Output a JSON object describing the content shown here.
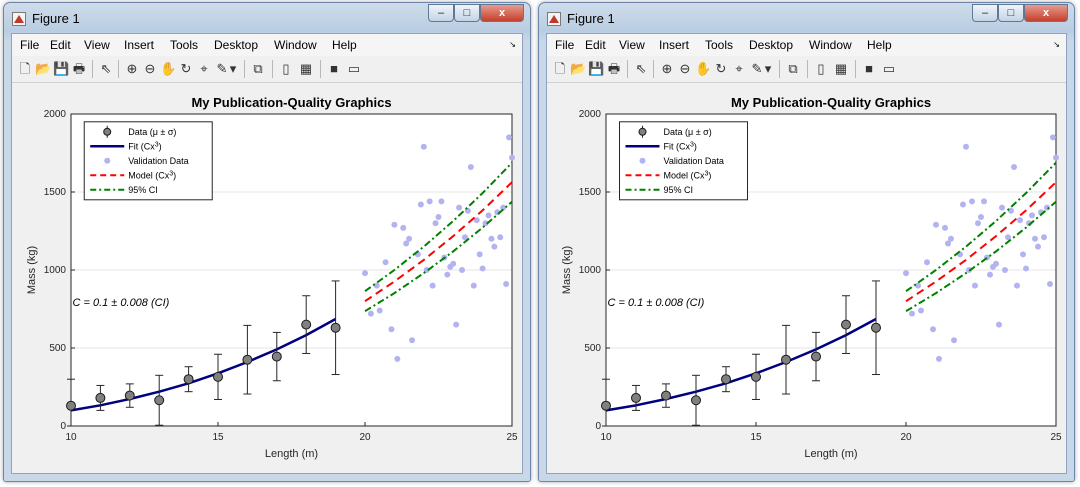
{
  "windows": [
    {
      "title": "Figure 1",
      "buttons": {
        "minimize": "–",
        "maximize": "□",
        "close": "x"
      },
      "menu": [
        "File",
        "Edit",
        "View",
        "Insert",
        "Tools",
        "Desktop",
        "Window",
        "Help"
      ],
      "menu_arrow": "↘"
    },
    {
      "title": "Figure 1",
      "buttons": {
        "minimize": "–",
        "maximize": "□",
        "close": "x"
      },
      "menu": [
        "File",
        "Edit",
        "View",
        "Insert",
        "Tools",
        "Desktop",
        "Window",
        "Help"
      ],
      "menu_arrow": "↘"
    }
  ],
  "toolbar_icons": [
    "new-figure-icon",
    "open-file-icon",
    "save-icon",
    "print-icon",
    "pointer-icon",
    "zoom-in-icon",
    "zoom-out-icon",
    "pan-icon",
    "rotate-3d-icon",
    "data-cursor-icon",
    "brush-icon",
    "brush-dropdown-icon",
    "link-plot-icon",
    "insert-colorbar-icon",
    "insert-legend-icon",
    "hide-plot-tools-icon",
    "show-plot-tools-icon"
  ],
  "toolbar_glyphs": [
    "🗋",
    "📂",
    "💾",
    "🖶",
    "⇖",
    "⊕",
    "⊖",
    "✋",
    "↻",
    "⌖",
    "✎",
    "▾",
    "⧉",
    "▯",
    "▦",
    "■",
    "▭"
  ],
  "chart_data": [
    {
      "type": "scatter",
      "title": "My Publication-Quality Graphics",
      "xlabel": "Length (m)",
      "ylabel": "Mass (kg)",
      "xlim": [
        10,
        25
      ],
      "ylim": [
        0,
        2000
      ],
      "xticks": [
        10,
        15,
        20,
        25
      ],
      "yticks": [
        0,
        500,
        1000,
        1500,
        2000
      ],
      "grid": "horizontal",
      "annotation": "C = 0.1 ± 0.008 (CI)",
      "legend": {
        "placement": "top-left",
        "entries": [
          "Data (μ ± σ)",
          "Fit (Cx³)",
          "Validation Data",
          "Model (Cx³)",
          "95% CI"
        ]
      },
      "colors": {
        "fit": "#000080",
        "validation": "#b3b3f2",
        "model": "#ff0000",
        "ci": "#008000",
        "data_marker": "#808080"
      },
      "data": {
        "x": [
          10,
          11,
          12,
          13,
          14,
          15,
          16,
          17,
          18,
          19
        ],
        "mean": [
          130,
          180,
          195,
          165,
          300,
          315,
          425,
          445,
          650,
          630
        ],
        "std": [
          170,
          80,
          75,
          160,
          80,
          145,
          220,
          155,
          185,
          300
        ]
      },
      "fit": {
        "x": [
          10,
          11,
          12,
          13,
          14,
          15,
          16,
          17,
          18,
          19
        ],
        "y": [
          100,
          133,
          173,
          220,
          274,
          338,
          410,
          491,
          583,
          686
        ]
      },
      "model": {
        "x": [
          20,
          21,
          22,
          23,
          24,
          25
        ],
        "y": [
          800,
          926,
          1065,
          1217,
          1382,
          1563
        ]
      },
      "ci_upper": {
        "x": [
          20,
          21,
          22,
          23,
          24,
          25
        ],
        "y": [
          864,
          1000,
          1150,
          1314,
          1493,
          1688
        ]
      },
      "ci_lower": {
        "x": [
          20,
          21,
          22,
          23,
          24,
          25
        ],
        "y": [
          736,
          852,
          980,
          1119,
          1272,
          1438
        ]
      },
      "validation": {
        "x": [
          20.0,
          20.2,
          20.4,
          20.5,
          20.7,
          20.9,
          21.0,
          21.1,
          21.3,
          21.4,
          21.5,
          21.6,
          21.8,
          21.9,
          22.0,
          22.1,
          22.2,
          22.3,
          22.4,
          22.5,
          22.6,
          22.7,
          22.8,
          22.9,
          23.0,
          23.1,
          23.2,
          23.3,
          23.4,
          23.5,
          23.6,
          23.7,
          23.8,
          23.9,
          24.0,
          24.1,
          24.2,
          24.3,
          24.4,
          24.5,
          24.6,
          24.7,
          24.8,
          24.9,
          25.0
        ],
        "y": [
          980,
          720,
          900,
          740,
          1050,
          620,
          1290,
          430,
          1270,
          1170,
          1200,
          550,
          1100,
          1420,
          1790,
          1000,
          1440,
          900,
          1300,
          1340,
          1440,
          1080,
          970,
          1020,
          1040,
          650,
          1400,
          1000,
          1210,
          1380,
          1660,
          900,
          1320,
          1100,
          1010,
          1300,
          1350,
          1200,
          1150,
          1370,
          1210,
          1400,
          910,
          1850,
          1720
        ]
      }
    },
    {
      "type": "scatter",
      "title": "My Publication-Quality Graphics",
      "xlabel": "Length (m)",
      "ylabel": "Mass (kg)",
      "xlim": [
        10,
        25
      ],
      "ylim": [
        0,
        2000
      ],
      "xticks": [
        10,
        15,
        20,
        25
      ],
      "yticks": [
        0,
        500,
        1000,
        1500,
        2000
      ],
      "grid": "horizontal",
      "annotation": "C = 0.1 ± 0.008 (CI)",
      "legend": {
        "placement": "top-left",
        "entries": [
          "Data (μ ± σ)",
          "Fit (Cx³)",
          "Validation Data",
          "Model (Cx³)",
          "95% CI"
        ]
      },
      "colors": {
        "fit": "#000080",
        "validation": "#b3b3f2",
        "model": "#ff0000",
        "ci": "#008000",
        "data_marker": "#808080"
      },
      "data": {
        "x": [
          10,
          11,
          12,
          13,
          14,
          15,
          16,
          17,
          18,
          19
        ],
        "mean": [
          130,
          180,
          195,
          165,
          300,
          315,
          425,
          445,
          650,
          630
        ],
        "std": [
          170,
          80,
          75,
          160,
          80,
          145,
          220,
          155,
          185,
          300
        ]
      },
      "fit": {
        "x": [
          10,
          11,
          12,
          13,
          14,
          15,
          16,
          17,
          18,
          19
        ],
        "y": [
          100,
          133,
          173,
          220,
          274,
          338,
          410,
          491,
          583,
          686
        ]
      },
      "model": {
        "x": [
          20,
          21,
          22,
          23,
          24,
          25
        ],
        "y": [
          800,
          926,
          1065,
          1217,
          1382,
          1563
        ]
      },
      "ci_upper": {
        "x": [
          20,
          21,
          22,
          23,
          24,
          25
        ],
        "y": [
          864,
          1000,
          1150,
          1314,
          1493,
          1688
        ]
      },
      "ci_lower": {
        "x": [
          20,
          21,
          22,
          23,
          24,
          25
        ],
        "y": [
          736,
          852,
          980,
          1119,
          1272,
          1438
        ]
      },
      "validation": {
        "x": [
          20.0,
          20.2,
          20.4,
          20.5,
          20.7,
          20.9,
          21.0,
          21.1,
          21.3,
          21.4,
          21.5,
          21.6,
          21.8,
          21.9,
          22.0,
          22.1,
          22.2,
          22.3,
          22.4,
          22.5,
          22.6,
          22.7,
          22.8,
          22.9,
          23.0,
          23.1,
          23.2,
          23.3,
          23.4,
          23.5,
          23.6,
          23.7,
          23.8,
          23.9,
          24.0,
          24.1,
          24.2,
          24.3,
          24.4,
          24.5,
          24.6,
          24.7,
          24.8,
          24.9,
          25.0
        ],
        "y": [
          980,
          720,
          900,
          740,
          1050,
          620,
          1290,
          430,
          1270,
          1170,
          1200,
          550,
          1100,
          1420,
          1790,
          1000,
          1440,
          900,
          1300,
          1340,
          1440,
          1080,
          970,
          1020,
          1040,
          650,
          1400,
          1000,
          1210,
          1380,
          1660,
          900,
          1320,
          1100,
          1010,
          1300,
          1350,
          1200,
          1150,
          1370,
          1210,
          1400,
          910,
          1850,
          1720
        ]
      }
    }
  ]
}
